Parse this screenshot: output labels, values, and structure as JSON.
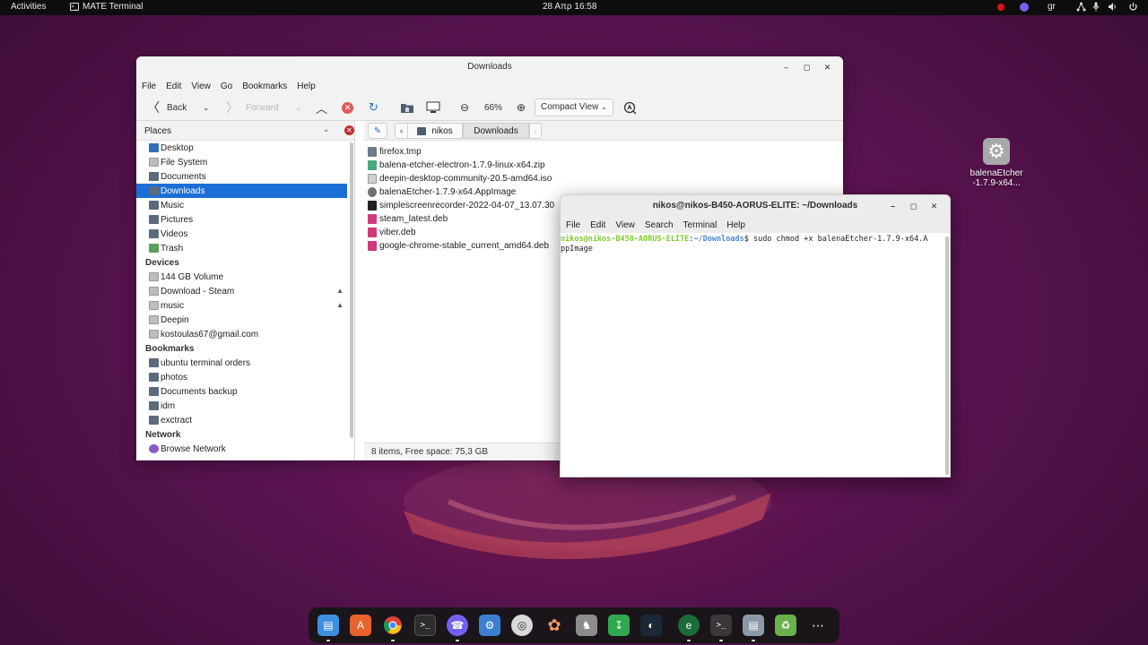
{
  "topbar": {
    "activities": "Activities",
    "app_name": "MATE Terminal",
    "clock": "28 Απρ  16:58",
    "language": "gr"
  },
  "file_manager": {
    "title": "Downloads",
    "menu": [
      "File",
      "Edit",
      "View",
      "Go",
      "Bookmarks",
      "Help"
    ],
    "toolbar": {
      "back": "Back",
      "forward": "Forward",
      "zoom": "66%",
      "view_mode": "Compact View"
    },
    "places_label": "Places",
    "places": [
      "Desktop",
      "File System",
      "Documents",
      "Downloads",
      "Music",
      "Pictures",
      "Videos",
      "Trash"
    ],
    "selected_place": "Downloads",
    "devices_label": "Devices",
    "devices": [
      "144 GB Volume",
      "Download - Steam",
      "music",
      "Deepin",
      "kostoulas67@gmail.com"
    ],
    "bookmarks_label": "Bookmarks",
    "bookmarks": [
      "ubuntu terminal orders",
      "photos",
      "Documents backup",
      "idm",
      "exctract"
    ],
    "network_label": "Network",
    "network": [
      "Browse Network"
    ],
    "path": [
      "nikos",
      "Downloads"
    ],
    "files": [
      "firefox.tmp",
      "balena-etcher-electron-1.7.9-linux-x64.zip",
      "deepin-desktop-community-20.5-amd64.iso",
      "balenaEtcher-1.7.9-x64.AppImage",
      "simplescreenrecorder-2022-04-07_13.07.30",
      "steam_latest.deb",
      "viber.deb",
      "google-chrome-stable_current_amd64.deb"
    ],
    "status": "8 items, Free space: 75,3 GB"
  },
  "terminal": {
    "title": "nikos@nikos-B450-AORUS-ELITE: ~/Downloads",
    "menu": [
      "File",
      "Edit",
      "View",
      "Search",
      "Terminal",
      "Help"
    ],
    "prompt_user": "nikos@nikos-B450-AORUS-ELITE",
    "prompt_sep": ":",
    "prompt_path": "~/Downloads",
    "command_line1": "$ sudo chmod +x balenaEtcher-1.7.9-x64.A",
    "command_line2": "ppImage"
  },
  "desktop_icon": {
    "label_line1": "balenaEtcher",
    "label_line2": "-1.7.9-x64..."
  },
  "dock_apps": [
    "files-icon",
    "software-icon",
    "chrome-icon",
    "terminal-icon",
    "viber-icon",
    "settings-icon",
    "disks-icon",
    "ark-icon",
    "gimp-icon",
    "download-icon",
    "steam-icon",
    "edge-icon",
    "mate-terminal-icon",
    "file-manager-icon",
    "trash-icon",
    "app-grid-icon"
  ]
}
